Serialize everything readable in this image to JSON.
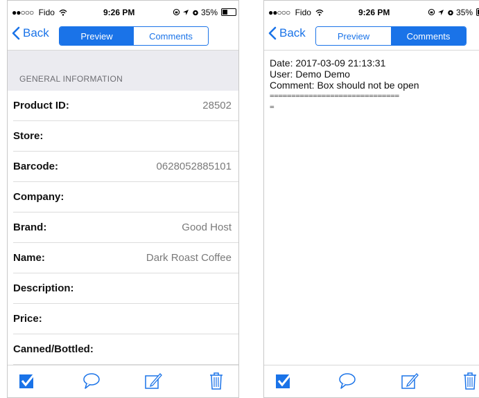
{
  "status_bar": {
    "signal": "●●○○○",
    "carrier": "Fido",
    "time": "9:26 PM",
    "battery_text": "35%",
    "battery_level": 0.35
  },
  "left_screen": {
    "nav": {
      "back_label": "Back",
      "tab_preview": "Preview",
      "tab_comments": "Comments",
      "active_tab": "Preview"
    },
    "section_header": "GENERAL INFORMATION",
    "rows": [
      {
        "label": "Product ID:",
        "value": "28502"
      },
      {
        "label": "Store:",
        "value": ""
      },
      {
        "label": "Barcode:",
        "value": "0628052885101"
      },
      {
        "label": "Company:",
        "value": ""
      },
      {
        "label": "Brand:",
        "value": "Good Host"
      },
      {
        "label": "Name:",
        "value": "Dark Roast Coffee"
      },
      {
        "label": "Description:",
        "value": ""
      },
      {
        "label": "Price:",
        "value": ""
      },
      {
        "label": "Canned/Bottled:",
        "value": ""
      }
    ]
  },
  "right_screen": {
    "nav": {
      "back_label": "Back",
      "tab_preview": "Preview",
      "tab_comments": "Comments",
      "active_tab": "Comments"
    },
    "comment": {
      "date_line": "Date: 2017-03-09 21:13:31",
      "user_line": "User: Demo Demo",
      "comment_line": "Comment: Box should not be open",
      "separator_line1": "==============================",
      "separator_line2": "="
    }
  },
  "toolbar": {
    "icons": [
      "checkbox-icon",
      "comment-bubble-icon",
      "edit-icon",
      "trash-icon"
    ],
    "accent_color": "#1a73e8"
  },
  "colors": {
    "accent": "#1a73e8",
    "section_bg": "#ebebf0",
    "value_text": "#7a7a7a"
  }
}
